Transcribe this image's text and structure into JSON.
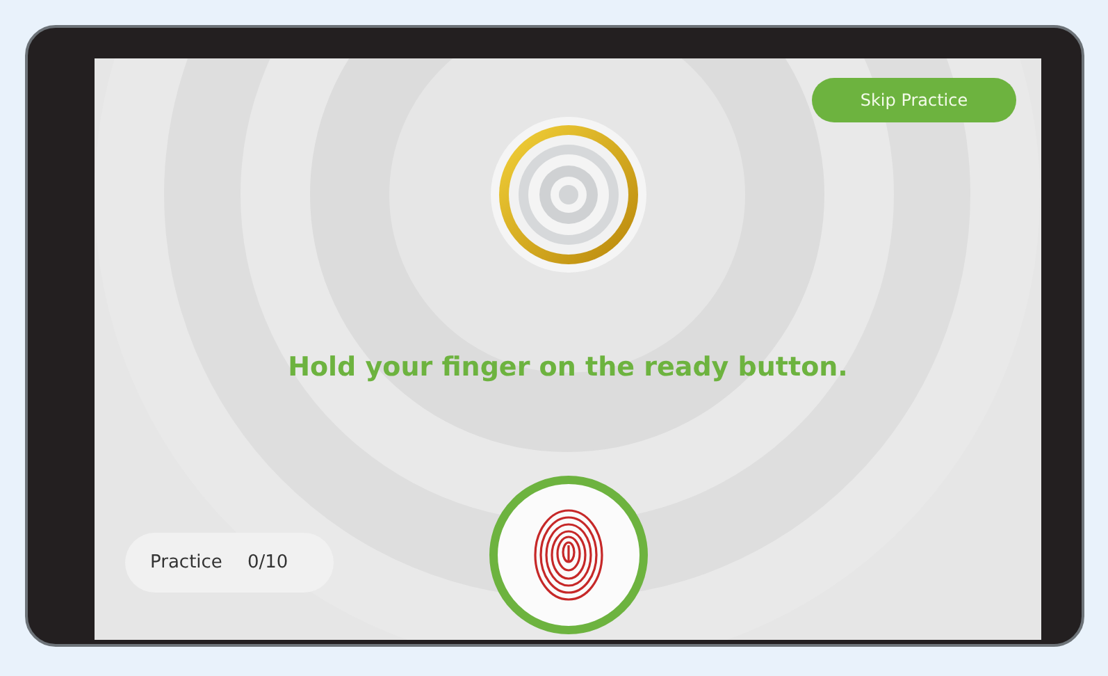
{
  "skip_button": {
    "label": "Skip Practice"
  },
  "message": "Hold your finger on the ready button.",
  "practice_counter": {
    "label": "Practice",
    "value": "0/10"
  }
}
